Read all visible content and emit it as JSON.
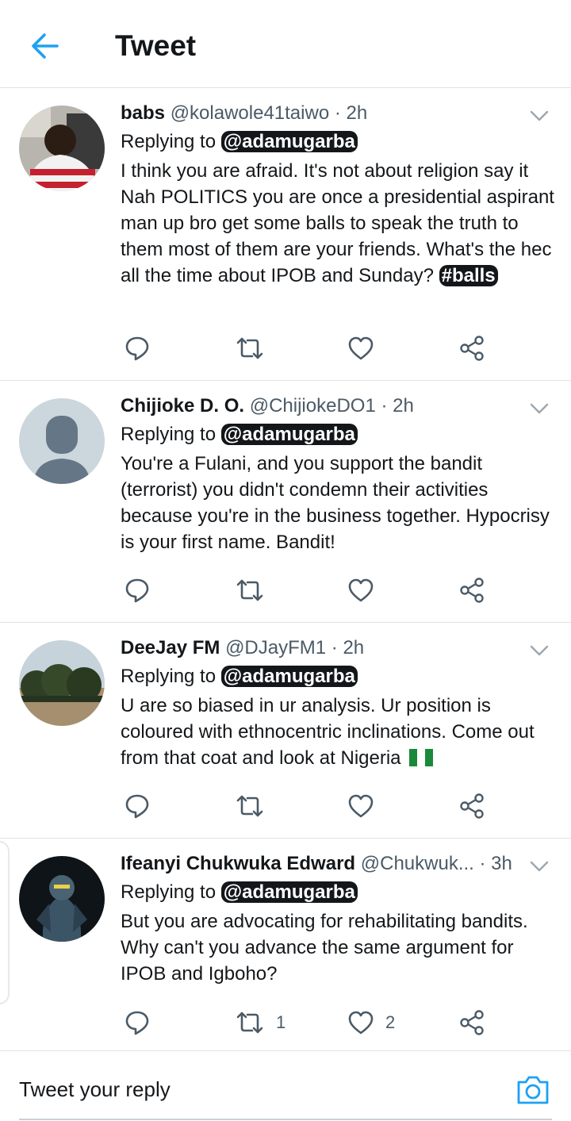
{
  "header": {
    "title": "Tweet"
  },
  "tweets": [
    {
      "name": "babs",
      "handle": "@kolawole41taiwo",
      "time": "· 2h",
      "replying_prefix": "Replying to",
      "mention": "@adamugarba",
      "text": "I think you are afraid. It's not about religion say it Nah POLITICS you are once a presidential aspirant man up bro get some balls to speak the truth to them most of them are your friends. What's the hec all the time about IPOB and Sunday? ",
      "hashtag": "#balls",
      "retweets": "",
      "likes": ""
    },
    {
      "name": "Chijioke D. O.",
      "handle": "@ChijiokeDO1",
      "time": "· 2h",
      "replying_prefix": "Replying to",
      "mention": "@adamugarba",
      "text": "You're a Fulani, and you support the bandit (terrorist) you didn't condemn their activities because you're in the business together. Hypocrisy is your first name. Bandit!",
      "retweets": "",
      "likes": ""
    },
    {
      "name": "DeeJay FM",
      "handle": "@DJayFM1",
      "time": "· 2h",
      "replying_prefix": "Replying to",
      "mention": "@adamugarba",
      "text": "U are so biased in ur analysis. Ur position is coloured with ethnocentric inclinations. Come out from that coat and look at Nigeria",
      "retweets": "",
      "likes": ""
    },
    {
      "name": "Ifeanyi Chukwuka Edward",
      "handle": "@Chukwuk...",
      "time": "· 3h",
      "replying_prefix": "Replying to",
      "mention": "@adamugarba",
      "text": "But you are advocating for rehabilitating bandits. Why can't you advance the same argument for IPOB and Igboho?",
      "retweets": "1",
      "likes": "2"
    }
  ],
  "reply_bar": {
    "placeholder": "Tweet your reply"
  },
  "colors": {
    "accent": "#1da1f2",
    "text": "#14171a",
    "muted": "#4b5a66",
    "divider": "#dfe3e6"
  },
  "icons": [
    "back-arrow-icon",
    "chevron-down-icon",
    "reply-icon",
    "retweet-icon",
    "like-icon",
    "share-icon",
    "camera-icon",
    "nigeria-flag-icon"
  ]
}
